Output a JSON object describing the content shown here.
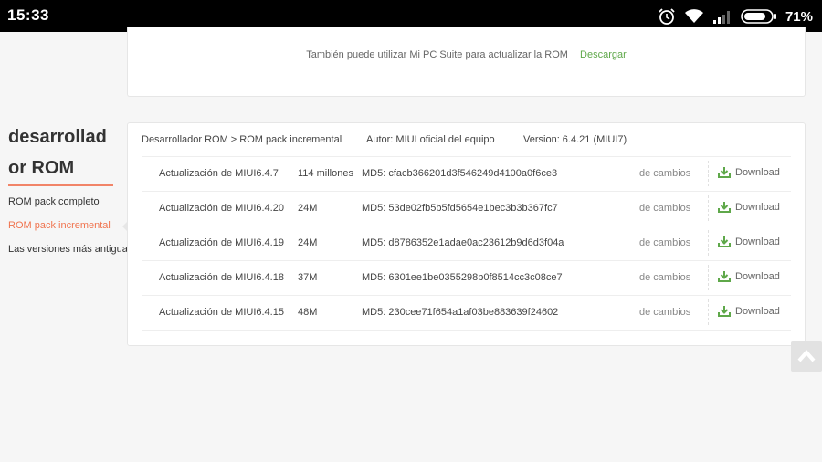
{
  "status_bar": {
    "time": "15:33",
    "battery": "71%",
    "icons": [
      "alarm-icon",
      "wifi-icon",
      "signal-icon",
      "battery-icon"
    ]
  },
  "top_card": {
    "text": "También puede utilizar Mi PC Suite para actualizar la ROM",
    "link": "Descargar"
  },
  "sidebar": {
    "title_line1": "desarrollad",
    "title_line2": "or ROM",
    "items": [
      {
        "label": "ROM pack completo",
        "active": false
      },
      {
        "label": "ROM pack incremental",
        "active": true
      },
      {
        "label": "Las versiones más antiguas",
        "active": false
      }
    ]
  },
  "main": {
    "breadcrumb": "Desarrollador ROM > ROM pack incremental",
    "author": "Autor: MIUI oficial del equipo",
    "version": "Version: 6.4.21 (MIUI7)",
    "rows": [
      {
        "name": "Actualización de MIUI6.4.7",
        "size": "114 millones",
        "md5": "MD5: cfacb366201d3f546249d4100a0f6ce3",
        "changes": "de cambios",
        "download": "Download"
      },
      {
        "name": "Actualización de MIUI6.4.20",
        "size": "24M",
        "md5": "MD5: 53de02fb5b5fd5654e1bec3b3b367fc7",
        "changes": "de cambios",
        "download": "Download"
      },
      {
        "name": "Actualización de MIUI6.4.19",
        "size": "24M",
        "md5": "MD5: d8786352e1adae0ac23612b9d6d3f04a",
        "changes": "de cambios",
        "download": "Download"
      },
      {
        "name": "Actualización de MIUI6.4.18",
        "size": "37M",
        "md5": "MD5: 6301ee1be0355298b0f8514cc3c08ce7",
        "changes": "de cambios",
        "download": "Download"
      },
      {
        "name": "Actualización de MIUI6.4.15",
        "size": "48M",
        "md5": "MD5: 230cee71f654a1af03be883639f24602",
        "changes": "de cambios",
        "download": "Download"
      }
    ]
  },
  "colors": {
    "accent": "#f0744f",
    "link_green": "#5fa84a",
    "download_icon": "#5fa84a"
  }
}
